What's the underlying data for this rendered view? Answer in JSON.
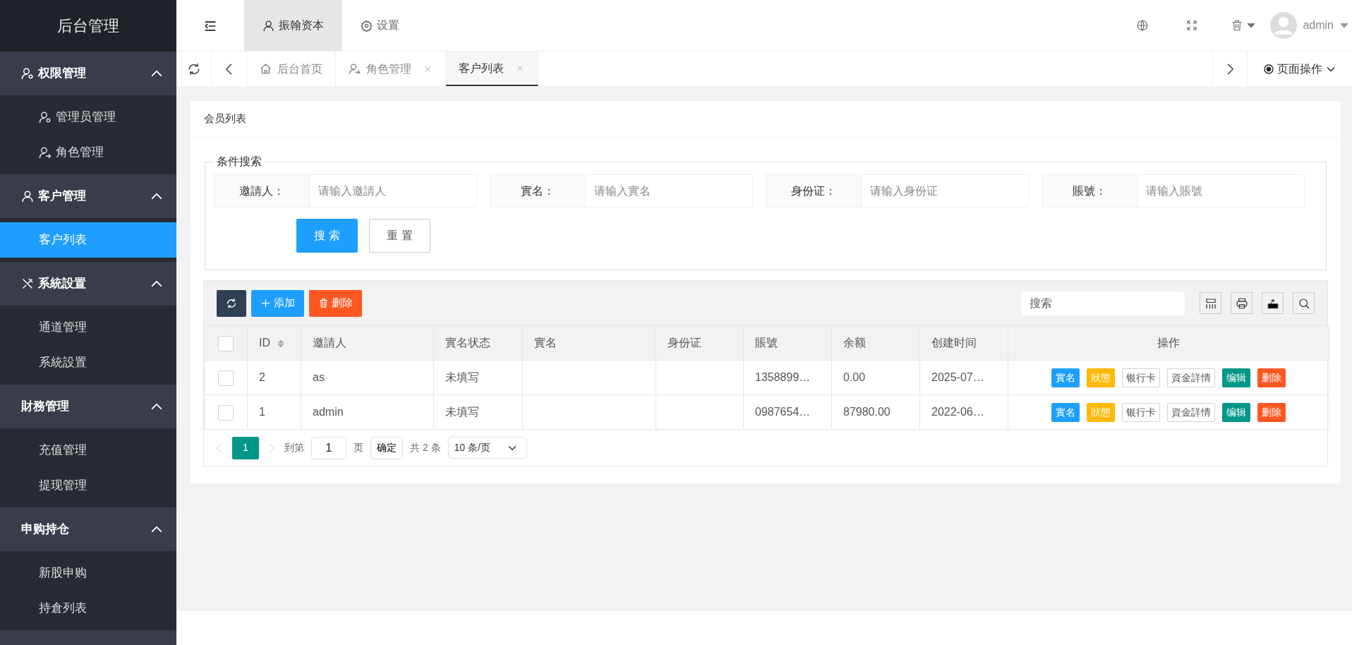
{
  "sidebar": {
    "title": "后台管理",
    "groups": [
      {
        "label": "权限管理",
        "kind": "admin",
        "expanded": true,
        "items": [
          {
            "label": "管理员管理",
            "kind": "admin",
            "selected": false
          },
          {
            "label": "角色管理",
            "kind": "role",
            "selected": false
          }
        ]
      },
      {
        "label": "客户管理",
        "kind": "customer",
        "expanded": true,
        "items": [
          {
            "label": "客户列表",
            "kind": "plain",
            "selected": true
          }
        ]
      },
      {
        "label": "系統設置",
        "kind": "tools",
        "expanded": true,
        "items": [
          {
            "label": "通道管理",
            "kind": "plain",
            "selected": false
          },
          {
            "label": "系統設置",
            "kind": "plain",
            "selected": false
          }
        ]
      },
      {
        "label": "財務管理",
        "kind": "plain",
        "expanded": true,
        "items": [
          {
            "label": "充值管理",
            "kind": "plain",
            "selected": false
          },
          {
            "label": "提现管理",
            "kind": "plain",
            "selected": false
          }
        ]
      },
      {
        "label": "申购持仓",
        "kind": "plain",
        "expanded": true,
        "items": [
          {
            "label": "新股申购",
            "kind": "plain",
            "selected": false
          },
          {
            "label": "持倉列表",
            "kind": "plain",
            "selected": false
          }
        ]
      }
    ]
  },
  "top_nav": {
    "tabs": [
      {
        "label": "振翰资本",
        "kind": "user",
        "selected": true
      },
      {
        "label": "设置",
        "kind": "gear",
        "selected": false
      }
    ],
    "user": "admin"
  },
  "page_tabs": {
    "tabs": [
      {
        "label": "后台首页",
        "kind": "home",
        "closable": false,
        "selected": false
      },
      {
        "label": "角色管理",
        "kind": "role",
        "closable": true,
        "selected": false
      },
      {
        "label": "客户列表",
        "kind": "plain",
        "closable": true,
        "selected": true
      }
    ],
    "actions": "页面操作"
  },
  "card": {
    "title": "会员列表",
    "search": {
      "legend": "条件搜索",
      "fields": [
        {
          "label": "邀請人：",
          "placeholder": "请输入邀請人"
        },
        {
          "label": "實名：",
          "placeholder": "请输入實名"
        },
        {
          "label": "身份证：",
          "placeholder": "请输入身份证"
        },
        {
          "label": "賬號：",
          "placeholder": "请输入賬號"
        }
      ],
      "buttons": [
        {
          "label": "搜 索",
          "kind": "primary"
        },
        {
          "label": "重 置",
          "kind": "plain"
        }
      ]
    },
    "toolbar": {
      "buttons": [
        {
          "label": "添加",
          "kind": "add"
        },
        {
          "label": "删除",
          "kind": "delete"
        }
      ],
      "search_placeholder": "搜索"
    },
    "table": {
      "select_all_checked": false,
      "columns": [
        "ID",
        "邀請人",
        "實名状态",
        "實名",
        "身份证",
        "賬號",
        "余额",
        "创建时间",
        "操作"
      ],
      "rows": [
        {
          "checked": false,
          "cells": [
            "2",
            "as",
            "未填写",
            "",
            "",
            "1358899…",
            "0.00",
            "2025-07…"
          ],
          "actions": [
            {
              "label": "實名",
              "kind": "filled",
              "color": "#1e9fff"
            },
            {
              "label": "狀態",
              "kind": "filled",
              "color": "#ffb800"
            },
            {
              "label": "银行卡",
              "kind": "outline"
            },
            {
              "label": "資金詳情",
              "kind": "outline"
            },
            {
              "label": "编辑",
              "kind": "filled",
              "color": "#009688"
            },
            {
              "label": "删除",
              "kind": "filled",
              "color": "#ff5722"
            }
          ]
        },
        {
          "checked": false,
          "cells": [
            "1",
            "admin",
            "未填写",
            "",
            "",
            "0987654…",
            "87980.00",
            "2022-06…"
          ],
          "actions": [
            {
              "label": "實名",
              "kind": "filled",
              "color": "#1e9fff"
            },
            {
              "label": "狀態",
              "kind": "filled",
              "color": "#ffb800"
            },
            {
              "label": "银行卡",
              "kind": "outline"
            },
            {
              "label": "資金詳情",
              "kind": "outline"
            },
            {
              "label": "编辑",
              "kind": "filled",
              "color": "#009688"
            },
            {
              "label": "删除",
              "kind": "filled",
              "color": "#ff5722"
            }
          ]
        }
      ]
    },
    "pagination": {
      "pages": [
        {
          "label": "1",
          "selected": true
        }
      ],
      "goto_label": "到第",
      "goto_value": "1",
      "page_unit": "页",
      "confirm": "确定",
      "total": "共 2 条",
      "page_size": "10 条/页"
    }
  }
}
